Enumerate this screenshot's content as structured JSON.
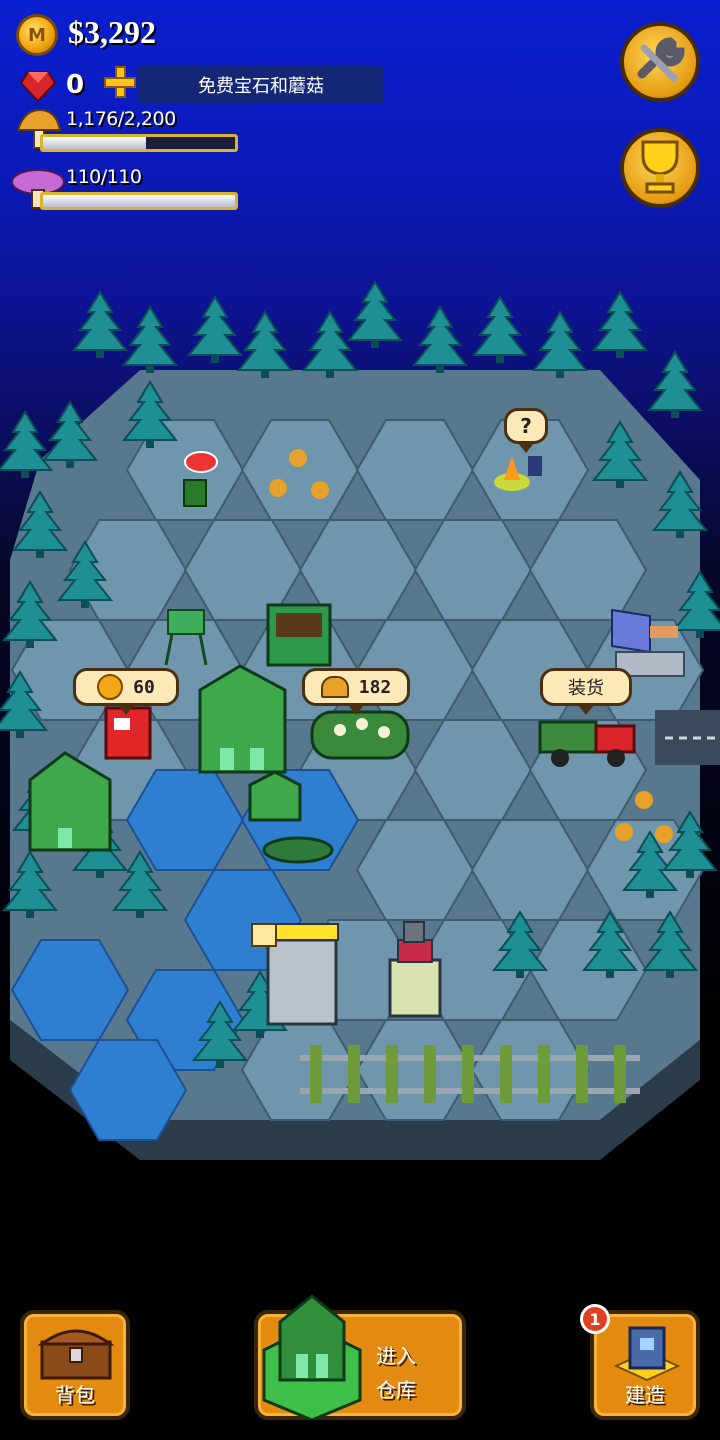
{
  "hud": {
    "money": "$3,292",
    "gems": "0",
    "free_offer": "免费宝石和蘑菇",
    "mushrooms": {
      "label": "1,176/2,200",
      "fraction": 0.535
    },
    "energy": {
      "label": "110/110",
      "fraction": 1.0
    },
    "icons": [
      "coin-icon",
      "gem-icon",
      "plus-icon",
      "mushroom-icon",
      "purple-mushroom-icon",
      "wrench-icon",
      "trophy-icon"
    ]
  },
  "map": {
    "vending_bubble": "60",
    "mushroom_log_bubble": "182",
    "truck_bubble": "装货",
    "quest_bubble": "?"
  },
  "bottom": {
    "backpack": "背包",
    "warehouse_line1": "进入",
    "warehouse_line2": "仓库",
    "build": "建造",
    "build_badge": "1"
  },
  "colors": {
    "sky_top": "#0a1fd0",
    "tree": "#1f8f96",
    "ground": "#6f96ac",
    "water": "#2f7fd0",
    "button": "#e38a10"
  }
}
